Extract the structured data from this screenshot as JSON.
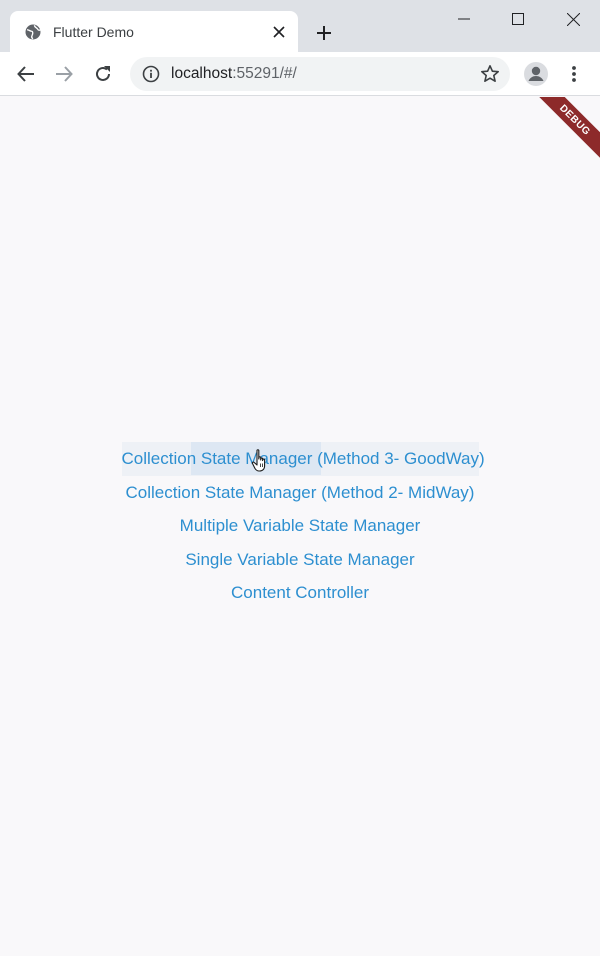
{
  "browser": {
    "tab": {
      "title": "Flutter Demo",
      "favicon": "globe-icon"
    },
    "address_bar": {
      "host": "localhost",
      "port_path": ":55291/#/"
    }
  },
  "app": {
    "debug_banner": "DEBUG",
    "menu_items": [
      "Collection State Manager (Method 3- GoodWay)",
      "Collection State Manager (Method 2- MidWay)",
      "Multiple Variable State Manager",
      "Single Variable State Manager",
      "Content Controller"
    ]
  },
  "colors": {
    "link": "#2d8fd0",
    "background": "#f9f8fa",
    "debug_banner": "#8d2a2a"
  }
}
